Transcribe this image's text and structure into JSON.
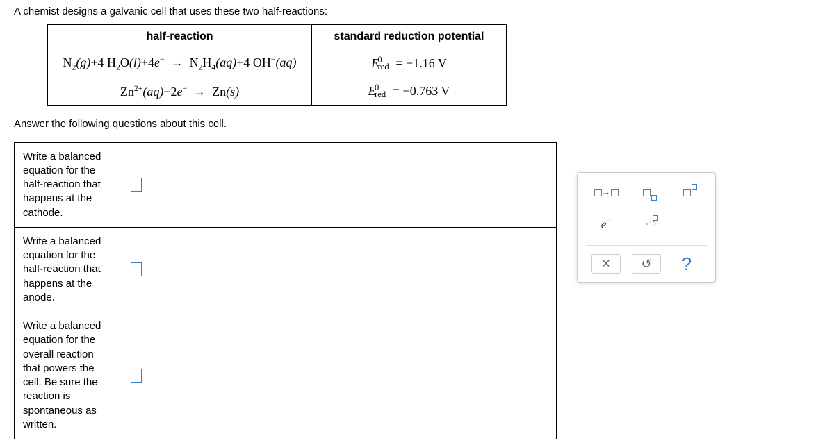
{
  "intro": "A chemist designs a galvanic cell that uses these two half-reactions:",
  "table": {
    "headers": [
      "half-reaction",
      "standard reduction potential"
    ],
    "rows": [
      {
        "equation": "N₂(g) + 4 H₂O(l) + 4e⁻  →  N₂H₄(aq) + 4 OH⁻(aq)",
        "potential_label": "E⁰_red",
        "potential_value": "= −1.16 V"
      },
      {
        "equation": "Zn²⁺(aq) + 2e⁻  →  Zn(s)",
        "potential_label": "E⁰_red",
        "potential_value": "= −0.763 V"
      }
    ]
  },
  "prompt": "Answer the following questions about this cell.",
  "questions": [
    "Write a balanced equation for the half-reaction that happens at the cathode.",
    "Write a balanced equation for the half-reaction that happens at the anode.",
    "Write a balanced equation for the overall reaction that powers the cell. Be sure the reaction is spontaneous as written."
  ],
  "toolbox": {
    "yields": "yields-tool",
    "subscript": "subscript-tool",
    "superscript": "superscript-tool",
    "electron": "e",
    "sci_notation": "×10",
    "clear": "×",
    "reset": "↺",
    "help": "?"
  }
}
